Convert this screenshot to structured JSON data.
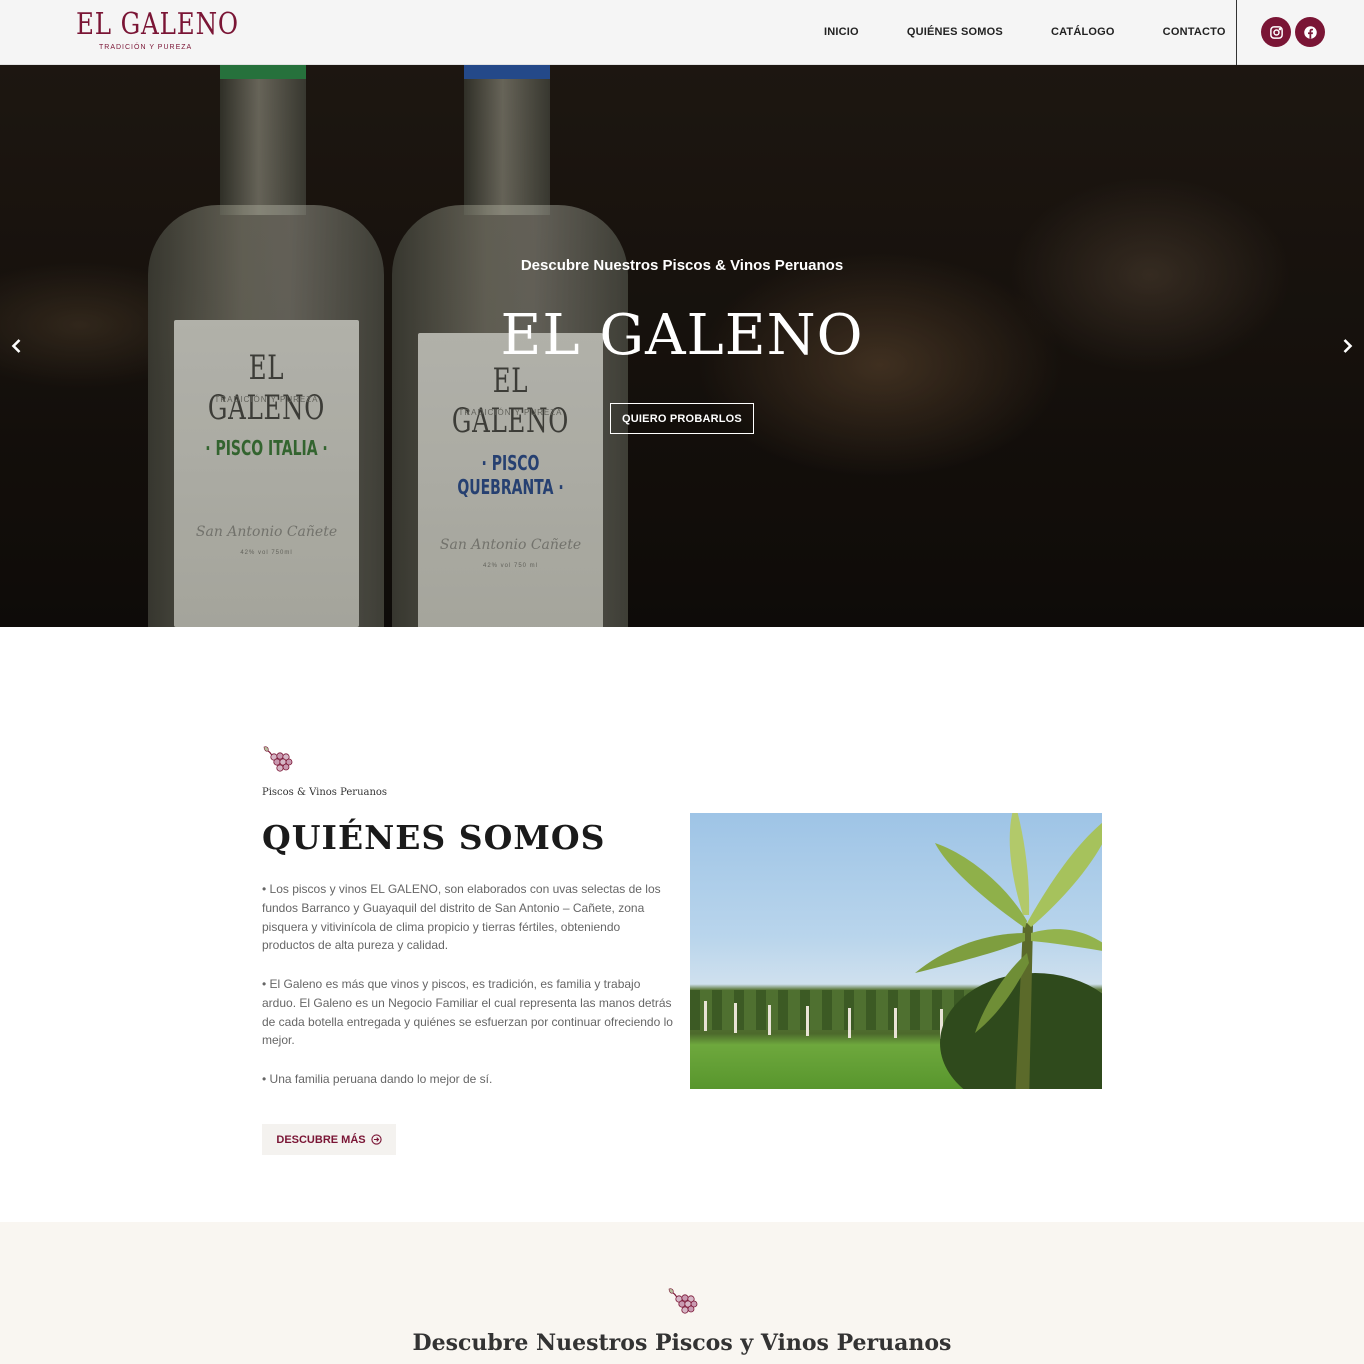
{
  "brand": {
    "name": "EL GALENO",
    "tagline": "TRADICIÓN Y PUREZA",
    "color": "#7a1535"
  },
  "nav": {
    "items": [
      {
        "label": "INICIO"
      },
      {
        "label": "QUIÉNES SOMOS"
      },
      {
        "label": "CATÁLOGO"
      },
      {
        "label": "CONTACTO"
      }
    ],
    "social": [
      {
        "icon": "instagram-icon"
      },
      {
        "icon": "facebook-icon"
      }
    ]
  },
  "hero": {
    "subtitle": "Descubre Nuestros Piscos & Vinos Peruanos",
    "title": "EL GALENO",
    "cta": "QUIERO PROBARLOS",
    "prev_icon": "chevron-left-icon",
    "next_icon": "chevron-right-icon",
    "bottles": [
      {
        "brand": "EL GALENO",
        "tag": "TRADICIÓN Y PUREZA",
        "type": "· PISCO ITALIA ·",
        "type_color": "#3f7a3a",
        "origin": "San Antonio Cañete",
        "specs": "42% vol   750ml"
      },
      {
        "brand": "EL GALENO",
        "tag": "TRADICIÓN Y PUREZA",
        "type": "· PISCO QUEBRANTA ·",
        "type_color": "#2f4f8a",
        "origin": "San Antonio Cañete",
        "specs": "42% vol   750 ml"
      }
    ]
  },
  "about": {
    "eyebrow": "Piscos & Vinos Peruanos",
    "title": "QUIÉNES SOMOS",
    "paragraphs": [
      "• Los piscos y vinos EL GALENO, son elaborados con uvas selectas de los fundos Barranco y Guayaquil del distrito de San Antonio – Cañete, zona pisquera y vitivinícola de clima propicio y tierras fértiles, obteniendo productos de alta pureza y calidad.",
      "• El Galeno es más que vinos y piscos, es tradición, es familia y trabajo arduo. El Galeno es un Negocio Familiar el cual representa las manos detrás de cada botella entregada y quiénes se esfuerzan por continuar ofreciendo lo mejor.",
      "• Una familia peruana dando lo mejor de sí."
    ],
    "button": "DESCUBRE MÁS",
    "button_icon": "arrow-circle-right-icon",
    "image": "vineyard-photo"
  },
  "catalog": {
    "title": "Descubre Nuestros Piscos y Vinos Peruanos"
  }
}
